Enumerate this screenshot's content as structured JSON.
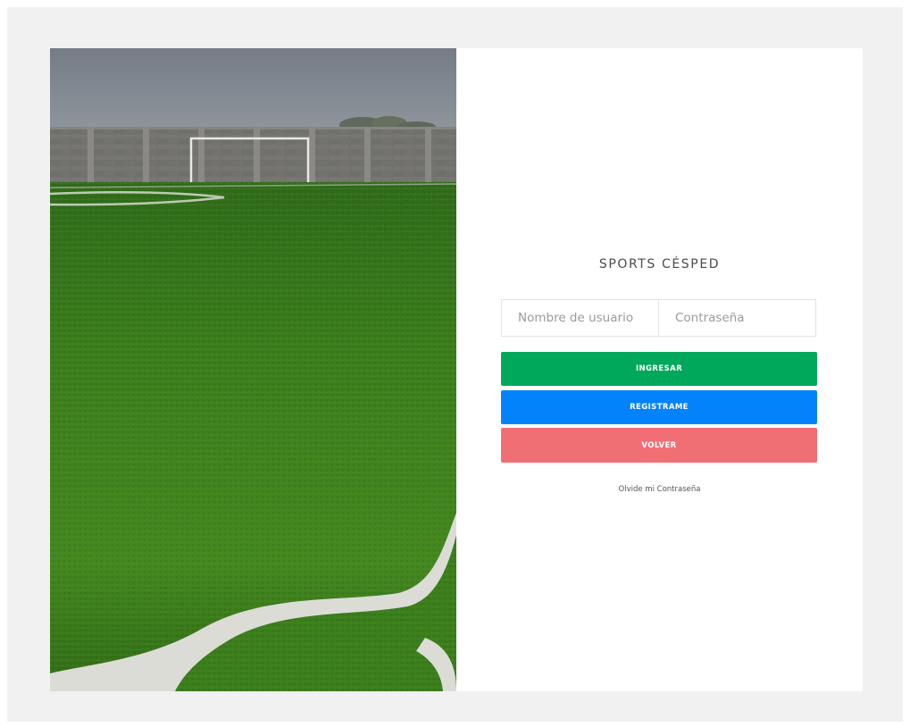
{
  "brand": {
    "title": "SPORTS CÉSPED"
  },
  "login_form": {
    "username_placeholder": "Nombre de usuario",
    "password_placeholder": "Contraseña",
    "login_label": "INGRESAR",
    "register_label": "REGISTRAME",
    "back_label": "VOLVER",
    "forgot_label": "Olvide mi Contraseña"
  },
  "colors": {
    "page_background": "#f1f1f1",
    "login_button": "#00a85c",
    "register_button": "#0283fb",
    "back_button": "#f06f75",
    "turf": "#3d7a1e"
  },
  "hero_image": {
    "subject": "artificial-turf-football-field"
  }
}
